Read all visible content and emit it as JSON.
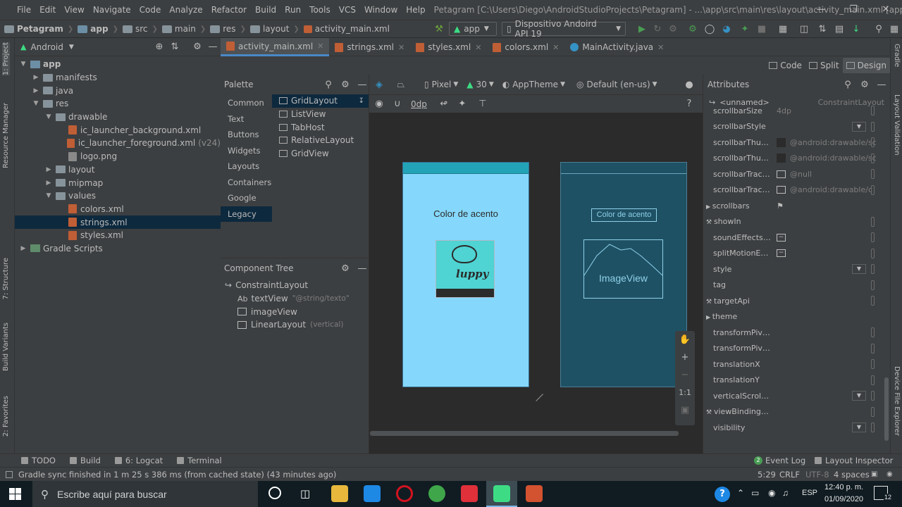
{
  "menu": {
    "items": [
      "File",
      "Edit",
      "View",
      "Navigate",
      "Code",
      "Analyze",
      "Refactor",
      "Build",
      "Run",
      "Tools",
      "VCS",
      "Window",
      "Help"
    ],
    "window_title": "Petagram [C:\\Users\\Diego\\AndroidStudioProjects\\Petagram] - ...\\app\\src\\main\\res\\layout\\activity_main.xml [app]"
  },
  "breadcrumb": [
    "Petagram",
    "app",
    "src",
    "main",
    "res",
    "layout",
    "activity_main.xml"
  ],
  "run_config": "app",
  "device": "Dispositivo Andoird API 19",
  "project_panel": {
    "view_mode": "Android",
    "tree": [
      {
        "label": "app",
        "level": 0,
        "type": "module",
        "expanded": true
      },
      {
        "label": "manifests",
        "level": 1,
        "type": "folder",
        "expanded": false
      },
      {
        "label": "java",
        "level": 1,
        "type": "folder",
        "expanded": false
      },
      {
        "label": "res",
        "level": 1,
        "type": "folder",
        "expanded": true
      },
      {
        "label": "drawable",
        "level": 2,
        "type": "folder",
        "expanded": true
      },
      {
        "label": "ic_launcher_background.xml",
        "level": 3,
        "type": "xml"
      },
      {
        "label": "ic_launcher_foreground.xml",
        "level": 3,
        "type": "xml",
        "suffix": "(v24)"
      },
      {
        "label": "logo.png",
        "level": 3,
        "type": "png"
      },
      {
        "label": "layout",
        "level": 2,
        "type": "folder",
        "expanded": false
      },
      {
        "label": "mipmap",
        "level": 2,
        "type": "folder",
        "expanded": false
      },
      {
        "label": "values",
        "level": 2,
        "type": "folder",
        "expanded": true
      },
      {
        "label": "colors.xml",
        "level": 3,
        "type": "xml"
      },
      {
        "label": "strings.xml",
        "level": 3,
        "type": "xml",
        "selected": true
      },
      {
        "label": "styles.xml",
        "level": 3,
        "type": "xml"
      },
      {
        "label": "Gradle Scripts",
        "level": 0,
        "type": "gradle",
        "expanded": false
      }
    ]
  },
  "left_stripe": [
    "1: Project",
    "Resource Manager",
    "7: Structure",
    "Build Variants",
    "2: Favorites"
  ],
  "right_stripe": [
    "Gradle",
    "Layout Validation",
    "Device File Explorer"
  ],
  "editor_tabs": [
    {
      "label": "activity_main.xml",
      "active": true,
      "kind": "xml"
    },
    {
      "label": "strings.xml",
      "kind": "xml"
    },
    {
      "label": "styles.xml",
      "kind": "xml"
    },
    {
      "label": "colors.xml",
      "kind": "xml"
    },
    {
      "label": "MainActivity.java",
      "kind": "java"
    }
  ],
  "modes": {
    "code": "Code",
    "split": "Split",
    "design": "Design"
  },
  "palette": {
    "title": "Palette",
    "categories": [
      "Common",
      "Text",
      "Buttons",
      "Widgets",
      "Layouts",
      "Containers",
      "Google",
      "Legacy"
    ],
    "selected_category": "Legacy",
    "items": [
      "GridLayout",
      "ListView",
      "TabHost",
      "RelativeLayout",
      "GridView"
    ]
  },
  "design_toolbar": {
    "device": "Pixel",
    "api": "30",
    "theme": "AppTheme",
    "locale": "Default (en-us)",
    "margin": "0dp"
  },
  "component_tree": {
    "title": "Component Tree",
    "items": [
      {
        "label": "ConstraintLayout",
        "level": 0
      },
      {
        "label": "textView",
        "level": 1,
        "prefix": "Ab",
        "note": "\"@string/texto\""
      },
      {
        "label": "imageView",
        "level": 1
      },
      {
        "label": "LinearLayout",
        "level": 1,
        "note": "(vertical)"
      }
    ]
  },
  "preview": {
    "text": "Color de acento",
    "logo_word": "luppy",
    "blueprint_text": "Color de acento",
    "blueprint_image_label": "ImageView",
    "zoom_controls": [
      "+",
      "−",
      "1:1"
    ]
  },
  "colors": {
    "accent": "#4a88c7",
    "preview_bg": "#85d8fb",
    "preview_status": "#22a3b8",
    "blueprint_bg": "#1f5165",
    "logo_bg": "#4fd3d3"
  },
  "attributes": {
    "title": "Attributes",
    "selected": "<unnamed>",
    "class": "ConstraintLayout",
    "rows": [
      {
        "name": "scrollbarSize",
        "value": "4dp"
      },
      {
        "name": "scrollbarStyle",
        "value": "",
        "dropdown": true
      },
      {
        "name": "scrollbarThumb...",
        "value": "@android:drawable/sc",
        "swatch": true
      },
      {
        "name": "scrollbarThumb...",
        "value": "@android:drawable/sc",
        "swatch": true
      },
      {
        "name": "scrollbarTrackH...",
        "value": "@null",
        "image": true
      },
      {
        "name": "scrollbarTrackV...",
        "value": "@android:drawable/c",
        "image": true
      },
      {
        "name": "scrollbars",
        "group": true,
        "flag": true
      },
      {
        "name": "showIn",
        "wrench": true
      },
      {
        "name": "soundEffectsEn...",
        "toggle": true
      },
      {
        "name": "splitMotionEve...",
        "toggle": true
      },
      {
        "name": "style",
        "dropdown": true
      },
      {
        "name": "tag"
      },
      {
        "name": "targetApi",
        "wrench": true
      },
      {
        "name": "theme",
        "group": true
      },
      {
        "name": "transformPivotX"
      },
      {
        "name": "transformPivotY"
      },
      {
        "name": "translationX"
      },
      {
        "name": "translationY"
      },
      {
        "name": "verticalScrollbar...",
        "dropdown": true
      },
      {
        "name": "viewBindingIg...",
        "wrench": true
      },
      {
        "name": "visibility",
        "dropdown": true
      }
    ]
  },
  "bottom_tools": {
    "left": [
      "TODO",
      "Build",
      "6: Logcat",
      "Terminal"
    ],
    "right": [
      "Event Log",
      "Layout Inspector"
    ],
    "event_count": "2"
  },
  "status": {
    "message": "Gradle sync finished in 1 m 25 s 386 ms (from cached state) (43 minutes ago)",
    "position": "5:29",
    "line_sep": "CRLF",
    "encoding": "UTF-8",
    "indent": "4 spaces"
  },
  "taskbar": {
    "search_placeholder": "Escribe aquí para buscar",
    "lang": "ESP",
    "time": "12:40 p. m.",
    "date": "01/09/2020",
    "notif_count": "12"
  }
}
